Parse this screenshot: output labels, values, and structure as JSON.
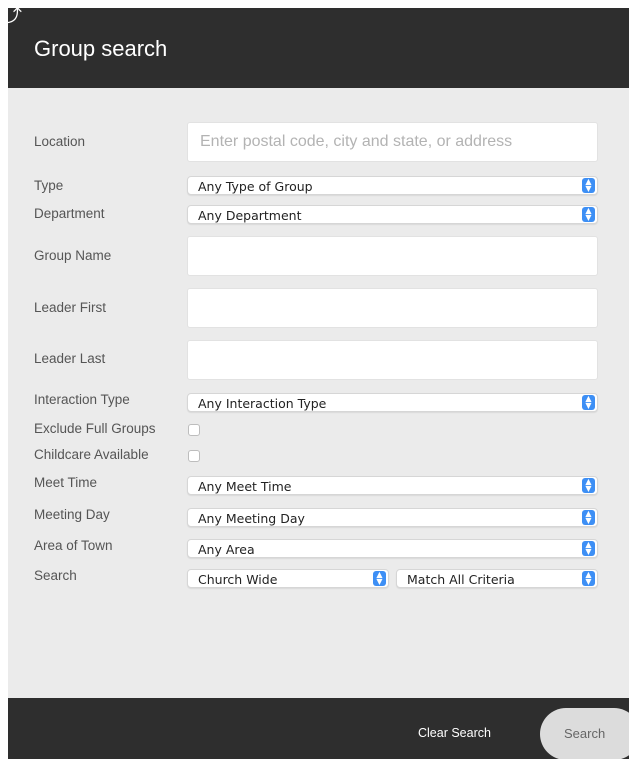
{
  "header": {
    "title": "Group search"
  },
  "form": {
    "location": {
      "label": "Location",
      "placeholder": "Enter postal code, city and state, or address",
      "value": ""
    },
    "type": {
      "label": "Type",
      "value": "Any Type of Group"
    },
    "department": {
      "label": "Department",
      "value": "Any Department"
    },
    "group_name": {
      "label": "Group Name",
      "value": ""
    },
    "leader_first": {
      "label": "Leader First",
      "value": ""
    },
    "leader_last": {
      "label": "Leader Last",
      "value": ""
    },
    "interaction_type": {
      "label": "Interaction Type",
      "value": "Any Interaction Type"
    },
    "exclude_full_groups": {
      "label": "Exclude Full Groups",
      "checked": false
    },
    "childcare_available": {
      "label": "Childcare Available",
      "checked": false
    },
    "meet_time": {
      "label": "Meet Time",
      "value": "Any Meet Time"
    },
    "meeting_day": {
      "label": "Meeting Day",
      "value": "Any Meeting Day"
    },
    "area_of_town": {
      "label": "Area of Town",
      "value": "Any Area"
    },
    "search": {
      "label": "Search",
      "scope_value": "Church Wide",
      "match_value": "Match All Criteria"
    }
  },
  "footer": {
    "clear_label": "Clear Search",
    "search_label": "Search"
  },
  "icons": {
    "select_arrow": "up-down-chevron-icon"
  },
  "colors": {
    "bar": "#2e2e2e",
    "panel": "#ebebeb",
    "accent": "#3d8ff5"
  }
}
